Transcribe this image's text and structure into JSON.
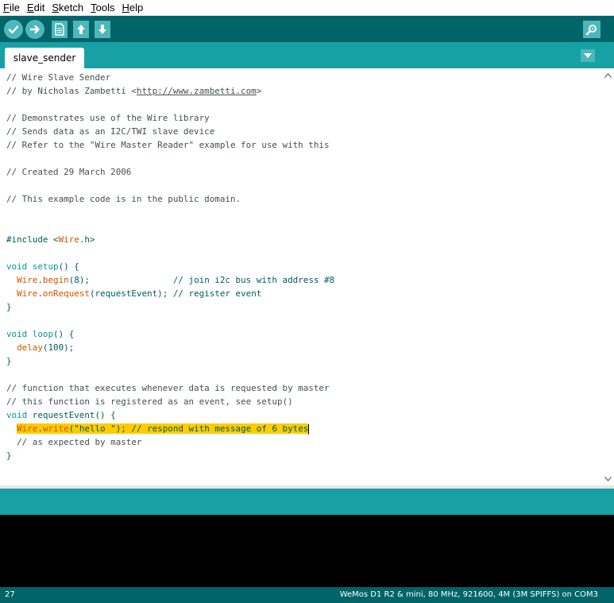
{
  "menu": {
    "items": [
      {
        "mnemonic": "F",
        "rest": "ile"
      },
      {
        "mnemonic": "E",
        "rest": "dit"
      },
      {
        "mnemonic": "S",
        "rest": "ketch"
      },
      {
        "mnemonic": "T",
        "rest": "ools"
      },
      {
        "mnemonic": "H",
        "rest": "elp"
      }
    ]
  },
  "toolbar": {
    "icons": [
      "checkmark-icon",
      "arrow-right-icon",
      "new-file-icon",
      "open-arrow-up-icon",
      "save-arrow-down-icon",
      "serial-monitor-icon"
    ]
  },
  "tab": {
    "label": "slave_sender"
  },
  "code": {
    "lines": [
      [
        {
          "t": "// Wire Slave Sender",
          "c": "c"
        }
      ],
      [
        {
          "t": "// by Nicholas Zambetti <",
          "c": "c"
        },
        {
          "t": "http://www.zambetti.com",
          "c": "url"
        },
        {
          "t": ">",
          "c": "c"
        }
      ],
      [],
      [
        {
          "t": "// Demonstrates use of the Wire library",
          "c": "c"
        }
      ],
      [
        {
          "t": "// Sends data as an I2C/TWI slave device",
          "c": "c"
        }
      ],
      [
        {
          "t": "// Refer to the \"Wire Master Reader\" example for use with this",
          "c": "c"
        }
      ],
      [],
      [
        {
          "t": "// Created 29 March 2006",
          "c": "c"
        }
      ],
      [],
      [
        {
          "t": "// This example code is in the public domain.",
          "c": "c"
        }
      ],
      [],
      [],
      [
        {
          "t": "#include <",
          "c": "t"
        },
        {
          "t": "Wire",
          "c": "f"
        },
        {
          "t": ".h>",
          "c": "t"
        }
      ],
      [],
      [
        {
          "t": "void",
          "c": "k"
        },
        {
          "t": " ",
          "c": "t"
        },
        {
          "t": "setup",
          "c": "k"
        },
        {
          "t": "() {",
          "c": "t"
        }
      ],
      [
        {
          "t": "  ",
          "c": "t"
        },
        {
          "t": "Wire",
          "c": "f"
        },
        {
          "t": ".",
          "c": "t"
        },
        {
          "t": "begin",
          "c": "f"
        },
        {
          "t": "(8);                // join i2c bus with address #8",
          "c": "t"
        }
      ],
      [
        {
          "t": "  ",
          "c": "t"
        },
        {
          "t": "Wire",
          "c": "f"
        },
        {
          "t": ".",
          "c": "t"
        },
        {
          "t": "onRequest",
          "c": "f"
        },
        {
          "t": "(requestEvent); // register event",
          "c": "t"
        }
      ],
      [
        {
          "t": "}",
          "c": "t"
        }
      ],
      [],
      [
        {
          "t": "void",
          "c": "k"
        },
        {
          "t": " ",
          "c": "t"
        },
        {
          "t": "loop",
          "c": "k"
        },
        {
          "t": "() {",
          "c": "t"
        }
      ],
      [
        {
          "t": "  ",
          "c": "t"
        },
        {
          "t": "delay",
          "c": "f"
        },
        {
          "t": "(100);",
          "c": "t"
        }
      ],
      [
        {
          "t": "}",
          "c": "t"
        }
      ],
      [],
      [
        {
          "t": "// function that executes whenever data is requested by master",
          "c": "c"
        }
      ],
      [
        {
          "t": "// this function is registered as an event, see setup()",
          "c": "c"
        }
      ],
      [
        {
          "t": "void",
          "c": "k"
        },
        {
          "t": " requestEvent() {",
          "c": "t"
        }
      ],
      [
        {
          "t": "  ",
          "c": "t"
        },
        {
          "t": "Wire",
          "c": "f hl"
        },
        {
          "t": ".",
          "c": "t hl"
        },
        {
          "t": "write",
          "c": "f hl"
        },
        {
          "t": "(\"hello \"); // respond with message of 6 bytes",
          "c": "t hl"
        },
        {
          "t": "",
          "c": "cursor"
        }
      ],
      [
        {
          "t": "  // as expected by master",
          "c": "c"
        }
      ],
      [
        {
          "t": "}",
          "c": "t"
        }
      ]
    ]
  },
  "status": {
    "line_number": "27",
    "board": "WeMos D1 R2 & mini, 80 MHz, 921600, 4M (3M SPIFFS) on COM3"
  },
  "colors": {
    "toolbar": "#006468",
    "tabbar": "#17a1a5",
    "button": "#4db7bb",
    "highlight": "#ffcc00",
    "keyword": "#00979c",
    "function": "#d35400"
  }
}
